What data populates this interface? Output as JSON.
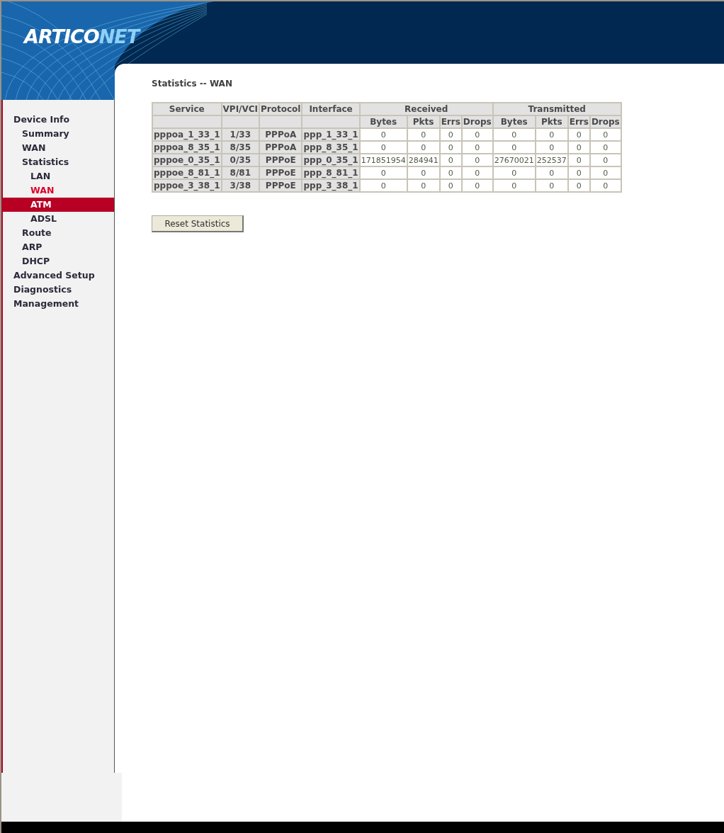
{
  "logo": [
    "ARTICO",
    "NET"
  ],
  "sidebar": {
    "items": [
      {
        "label": "Device Info",
        "selected": false,
        "highlighted": false,
        "children": [
          {
            "label": "Summary",
            "selected": false,
            "highlighted": false
          },
          {
            "label": "WAN",
            "selected": false,
            "highlighted": false
          },
          {
            "label": "Statistics",
            "selected": false,
            "highlighted": false,
            "children": [
              {
                "label": "LAN",
                "selected": false,
                "highlighted": false
              },
              {
                "label": "WAN",
                "selected": true,
                "highlighted": false
              },
              {
                "label": "ATM",
                "selected": false,
                "highlighted": true
              },
              {
                "label": "ADSL",
                "selected": false,
                "highlighted": false
              }
            ]
          },
          {
            "label": "Route",
            "selected": false,
            "highlighted": false
          },
          {
            "label": "ARP",
            "selected": false,
            "highlighted": false
          },
          {
            "label": "DHCP",
            "selected": false,
            "highlighted": false
          }
        ]
      },
      {
        "label": "Advanced Setup",
        "selected": false,
        "highlighted": false
      },
      {
        "label": "Diagnostics",
        "selected": false,
        "highlighted": false
      },
      {
        "label": "Management",
        "selected": false,
        "highlighted": false
      }
    ]
  },
  "page_title": "Statistics -- WAN",
  "table": {
    "columns": [
      "Service",
      "VPI/VCI",
      "Protocol",
      "Interface"
    ],
    "groups": [
      {
        "label": "Received",
        "columns": [
          "Bytes",
          "Pkts",
          "Errs",
          "Drops"
        ]
      },
      {
        "label": "Transmitted",
        "columns": [
          "Bytes",
          "Pkts",
          "Errs",
          "Drops"
        ]
      }
    ],
    "rows": [
      [
        "pppoa_1_33_1",
        "1/33",
        "PPPoA",
        "ppp_1_33_1",
        "0",
        "0",
        "0",
        "0",
        "0",
        "0",
        "0",
        "0"
      ],
      [
        "pppoa_8_35_1",
        "8/35",
        "PPPoA",
        "ppp_8_35_1",
        "0",
        "0",
        "0",
        "0",
        "0",
        "0",
        "0",
        "0"
      ],
      [
        "pppoe_0_35_1",
        "0/35",
        "PPPoE",
        "ppp_0_35_1",
        "171851954",
        "284941",
        "0",
        "0",
        "27670021",
        "252537",
        "0",
        "0"
      ],
      [
        "pppoe_8_81_1",
        "8/81",
        "PPPoE",
        "ppp_8_81_1",
        "0",
        "0",
        "0",
        "0",
        "0",
        "0",
        "0",
        "0"
      ],
      [
        "pppoe_3_38_1",
        "3/38",
        "PPPoE",
        "ppp_3_38_1",
        "0",
        "0",
        "0",
        "0",
        "0",
        "0",
        "0",
        "0"
      ]
    ]
  },
  "buttons": [
    "Reset Statistics"
  ]
}
